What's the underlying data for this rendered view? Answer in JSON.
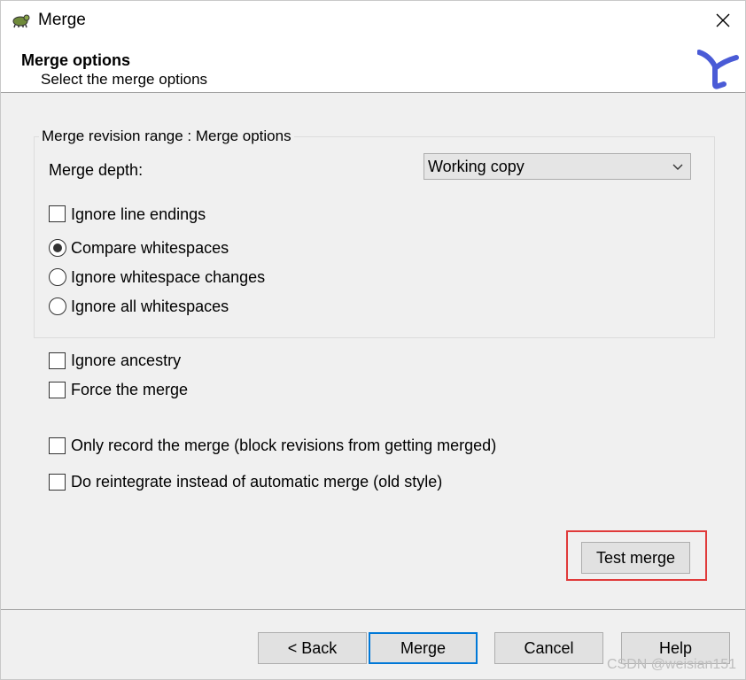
{
  "window": {
    "title": "Merge"
  },
  "header": {
    "title": "Merge options",
    "subtitle": "Select the merge options"
  },
  "group": {
    "legend": "Merge revision range : Merge options",
    "merge_depth_label": "Merge depth:",
    "merge_depth_value": "Working copy",
    "ignore_line_endings": {
      "label": "Ignore line endings",
      "checked": false
    },
    "whitespace_options": [
      {
        "label": "Compare whitespaces",
        "selected": true
      },
      {
        "label": "Ignore whitespace changes",
        "selected": false
      },
      {
        "label": "Ignore all whitespaces",
        "selected": false
      }
    ]
  },
  "options": [
    {
      "label": "Ignore ancestry",
      "checked": false
    },
    {
      "label": "Force the merge",
      "checked": false
    },
    {
      "label": "Only record the merge (block revisions from getting merged)",
      "checked": false
    },
    {
      "label": "Do reintegrate instead of automatic merge (old style)",
      "checked": false
    }
  ],
  "test_merge_button": "Test merge",
  "footer_buttons": {
    "back": "< Back",
    "merge": "Merge",
    "cancel": "Cancel",
    "help": "Help"
  },
  "watermark": "CSDN @weisian151",
  "colors": {
    "highlight": "#e03a3a",
    "default_button_border": "#0078d7",
    "logo": "#4a5bd6"
  }
}
